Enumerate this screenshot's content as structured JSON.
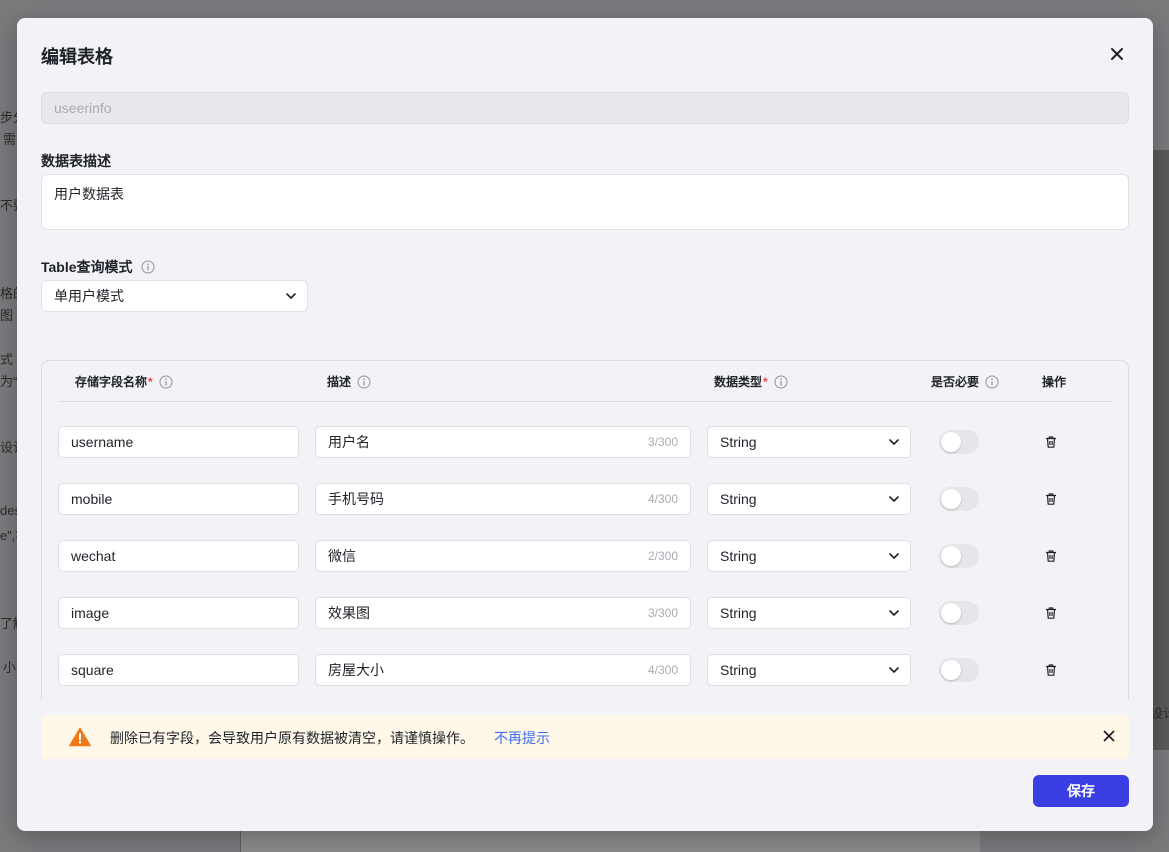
{
  "background": {
    "fragments": [
      "步分",
      "需",
      "不要",
      "格的",
      "图",
      "式",
      "为“(",
      "设计",
      "des",
      "e”,将",
      "了解",
      "小",
      "设计"
    ]
  },
  "modal": {
    "title": "编辑表格",
    "close_icon": "close-icon",
    "table_name": {
      "value": "useerinfo"
    },
    "description": {
      "label": "数据表描述",
      "value": "用户数据表"
    },
    "query_mode": {
      "label": "Table查询模式",
      "selected": "单用户模式"
    },
    "table": {
      "headers": {
        "field_name": "存储字段名称",
        "description": "描述",
        "data_type": "数据类型",
        "required": "是否必要",
        "actions": "操作",
        "required_mark": "*"
      },
      "rows": [
        {
          "field": "username",
          "desc": "用户名",
          "count": "3/300",
          "type": "String",
          "required": false
        },
        {
          "field": "mobile",
          "desc": "手机号码",
          "count": "4/300",
          "type": "String",
          "required": false
        },
        {
          "field": "wechat",
          "desc": "微信",
          "count": "2/300",
          "type": "String",
          "required": false
        },
        {
          "field": "image",
          "desc": "效果图",
          "count": "3/300",
          "type": "String",
          "required": false
        },
        {
          "field": "square",
          "desc": "房屋大小",
          "count": "4/300",
          "type": "String",
          "required": false
        }
      ]
    },
    "alert": {
      "text": "删除已有字段，会导致用户原有数据被清空，请谨慎操作。",
      "link": "不再提示",
      "icon": "warning-icon",
      "color": "#f07a1a"
    },
    "save_label": "保存",
    "accent_color": "#3b3ee2"
  }
}
